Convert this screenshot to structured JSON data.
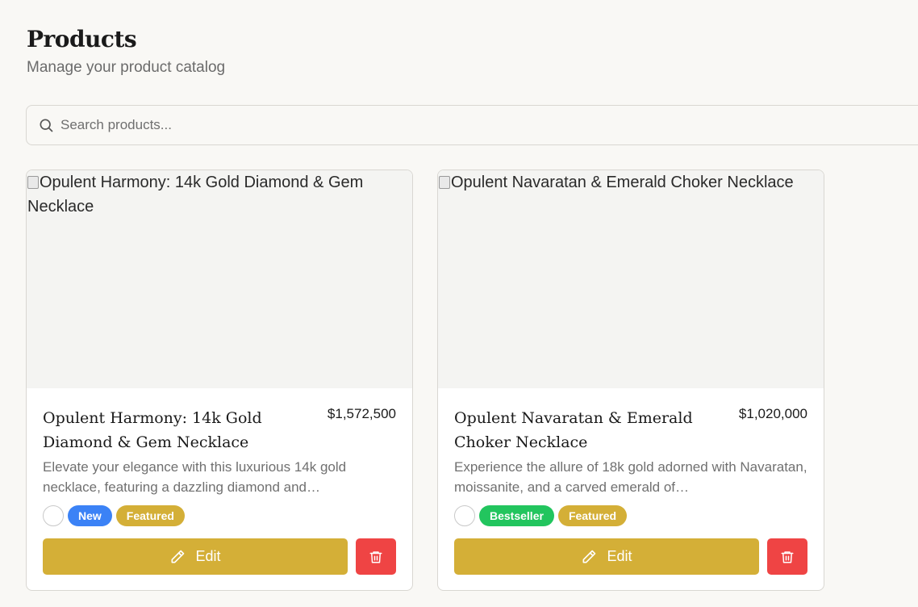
{
  "header": {
    "title": "Products",
    "subtitle": "Manage your product catalog"
  },
  "search": {
    "placeholder": "Search products...",
    "value": ""
  },
  "colors": {
    "gold": "#d4af37",
    "danger": "#ef4444",
    "new": "#3b82f6",
    "bestseller": "#22c55e"
  },
  "products": [
    {
      "image_alt": "Opulent Harmony: 14k Gold Diamond & Gem Necklace",
      "name": "Opulent Harmony: 14k Gold Diamond & Gem Necklace",
      "price": "$1,572,500",
      "description": "Elevate your elegance with this luxurious 14k gold necklace, featuring a dazzling diamond and…",
      "tags": [
        {
          "label": "New",
          "color": "#3b82f6"
        },
        {
          "label": "Featured",
          "color": "#d4af37"
        }
      ],
      "edit_label": "Edit",
      "icons": {
        "edit": "pencil-icon",
        "delete": "trash-icon"
      }
    },
    {
      "image_alt": "Opulent Navaratan & Emerald Choker Necklace",
      "name": "Opulent Navaratan & Emerald Choker Necklace",
      "price": "$1,020,000",
      "description": "Experience the allure of 18k gold adorned with Navaratan, moissanite, and a carved emerald of…",
      "tags": [
        {
          "label": "Bestseller",
          "color": "#22c55e"
        },
        {
          "label": "Featured",
          "color": "#d4af37"
        }
      ],
      "edit_label": "Edit",
      "icons": {
        "edit": "pencil-icon",
        "delete": "trash-icon"
      }
    }
  ]
}
